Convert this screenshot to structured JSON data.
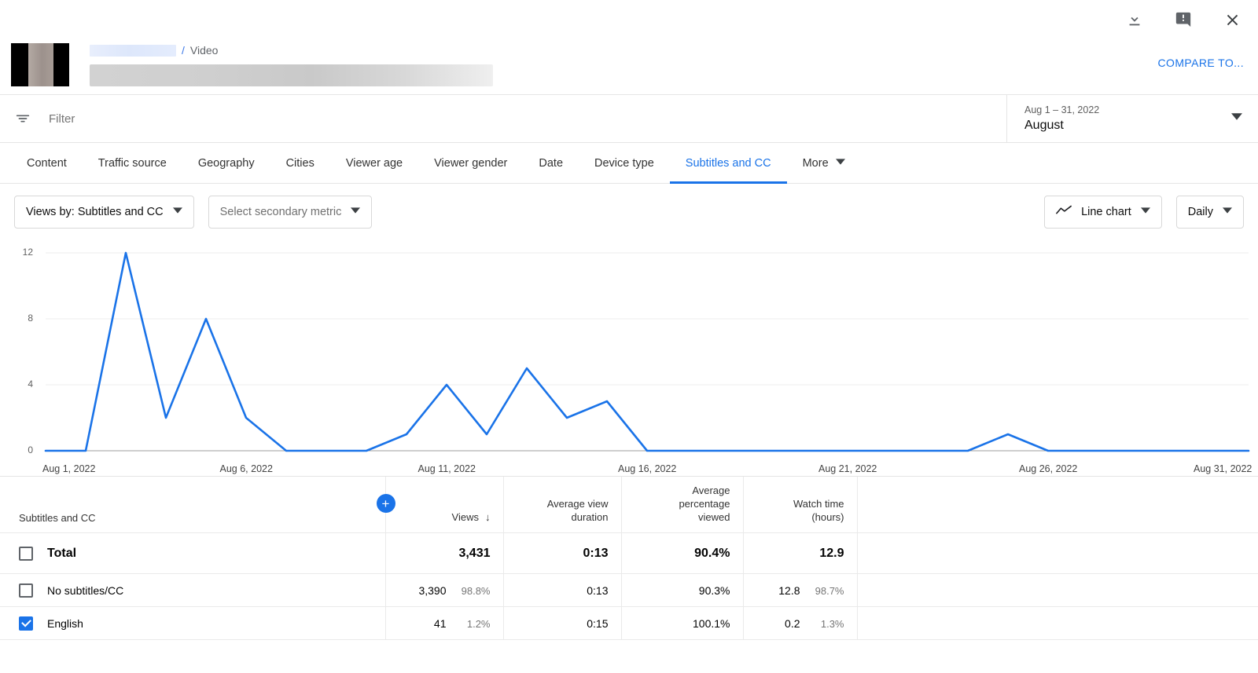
{
  "topbar": {
    "download_icon": "download-icon",
    "feedback_icon": "feedback-icon",
    "close_icon": "close-icon",
    "compare_label": "COMPARE TO...",
    "breadcrumb_separator": "/",
    "breadcrumb_type": "Video"
  },
  "filterbar": {
    "filter_placeholder": "Filter",
    "date_range": "Aug 1 – 31, 2022",
    "date_preset": "August"
  },
  "tabs": [
    {
      "label": "Content",
      "active": false
    },
    {
      "label": "Traffic source",
      "active": false
    },
    {
      "label": "Geography",
      "active": false
    },
    {
      "label": "Cities",
      "active": false
    },
    {
      "label": "Viewer age",
      "active": false
    },
    {
      "label": "Viewer gender",
      "active": false
    },
    {
      "label": "Date",
      "active": false
    },
    {
      "label": "Device type",
      "active": false
    },
    {
      "label": "Subtitles and CC",
      "active": true
    }
  ],
  "more_tab": "More",
  "chart_controls": {
    "primary_metric": "Views by: Subtitles and CC",
    "secondary_metric": "Select secondary metric",
    "chart_type": "Line chart",
    "granularity": "Daily"
  },
  "chart_data": {
    "type": "line",
    "title": "Views by: Subtitles and CC",
    "xlabel": "",
    "ylabel": "Views",
    "ylim": [
      0,
      12
    ],
    "yticks": [
      0,
      4,
      8,
      12
    ],
    "grid": true,
    "legend": "none",
    "line_color": "#1a73e8",
    "x": [
      "Aug 1, 2022",
      "Aug 2, 2022",
      "Aug 3, 2022",
      "Aug 4, 2022",
      "Aug 5, 2022",
      "Aug 6, 2022",
      "Aug 7, 2022",
      "Aug 8, 2022",
      "Aug 9, 2022",
      "Aug 10, 2022",
      "Aug 11, 2022",
      "Aug 12, 2022",
      "Aug 13, 2022",
      "Aug 14, 2022",
      "Aug 15, 2022",
      "Aug 16, 2022",
      "Aug 17, 2022",
      "Aug 18, 2022",
      "Aug 19, 2022",
      "Aug 20, 2022",
      "Aug 21, 2022",
      "Aug 22, 2022",
      "Aug 23, 2022",
      "Aug 24, 2022",
      "Aug 25, 2022",
      "Aug 26, 2022",
      "Aug 27, 2022",
      "Aug 28, 2022",
      "Aug 29, 2022",
      "Aug 30, 2022",
      "Aug 31, 2022"
    ],
    "xtick_labels": [
      "Aug 1, 2022",
      "Aug 6, 2022",
      "Aug 11, 2022",
      "Aug 16, 2022",
      "Aug 21, 2022",
      "Aug 26, 2022",
      "Aug 31, 2022"
    ],
    "xtick_indices": [
      0,
      5,
      10,
      15,
      20,
      25,
      30
    ],
    "series": [
      {
        "name": "English",
        "values": [
          0,
          0,
          12,
          2,
          8,
          2,
          0,
          0,
          0,
          1,
          4,
          1,
          5,
          2,
          3,
          0,
          0,
          0,
          0,
          0,
          0,
          0,
          0,
          0,
          1,
          0,
          0,
          0,
          0,
          0,
          0
        ]
      }
    ]
  },
  "table": {
    "headers": {
      "dimension": "Subtitles and CC",
      "views": "Views",
      "sort_arrow": "↓",
      "avg_view_duration": "Average view\nduration",
      "avg_percentage_viewed": "Average\npercentage\nviewed",
      "watch_time": "Watch time\n(hours)",
      "add_metric_icon": "plus-icon"
    },
    "total_row": {
      "label": "Total",
      "checked": false,
      "views": "3,431",
      "views_pct": "",
      "avg_view_duration": "0:13",
      "avg_percentage_viewed": "90.4%",
      "watch_time": "12.9",
      "watch_time_pct": ""
    },
    "rows": [
      {
        "label": "No subtitles/CC",
        "checked": false,
        "views": "3,390",
        "views_pct": "98.8%",
        "avg_view_duration": "0:13",
        "avg_percentage_viewed": "90.3%",
        "watch_time": "12.8",
        "watch_time_pct": "98.7%"
      },
      {
        "label": "English",
        "checked": true,
        "views": "41",
        "views_pct": "1.2%",
        "avg_view_duration": "0:15",
        "avg_percentage_viewed": "100.1%",
        "watch_time": "0.2",
        "watch_time_pct": "1.3%"
      }
    ]
  },
  "colors": {
    "accent": "#1a73e8",
    "border": "#e5e5e5",
    "muted_text": "#606060"
  }
}
